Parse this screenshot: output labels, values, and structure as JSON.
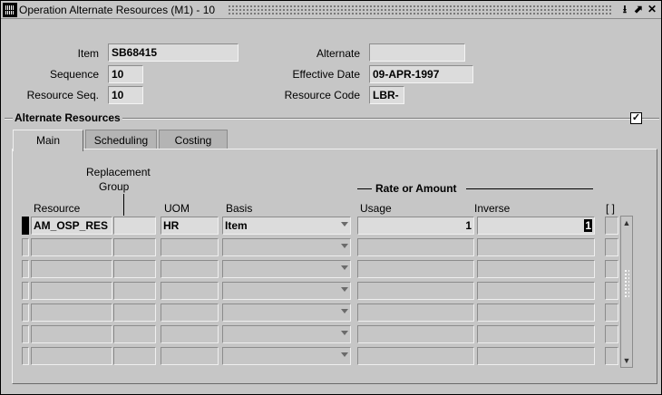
{
  "window": {
    "title": "Operation Alternate Resources (M1) - 10",
    "icons": [
      "form-icon",
      "minimize-icon",
      "maximize-icon",
      "close-icon"
    ]
  },
  "header_fields": {
    "item": {
      "label": "Item",
      "value": "SB68415"
    },
    "sequence": {
      "label": "Sequence",
      "value": "10"
    },
    "resource_seq": {
      "label": "Resource Seq.",
      "value": "10"
    },
    "alternate": {
      "label": "Alternate",
      "value": ""
    },
    "effective_date": {
      "label": "Effective Date",
      "value": "09-APR-1997"
    },
    "resource_code": {
      "label": "Resource Code",
      "value": "LBR-"
    }
  },
  "section": {
    "title": "Alternate Resources",
    "checked": true
  },
  "tabs": [
    {
      "label": "Main",
      "active": true
    },
    {
      "label": "Scheduling",
      "active": false
    },
    {
      "label": "Costing",
      "active": false
    }
  ],
  "table": {
    "headers": {
      "resource": "Resource",
      "replacement_group_1": "Replacement",
      "replacement_group_2": "Group",
      "uom": "UOM",
      "basis": "Basis",
      "rate_group": "Rate or Amount",
      "usage": "Usage",
      "inverse": "Inverse",
      "extra": "[ ]"
    },
    "rows": [
      {
        "resource": "AM_OSP_RES",
        "replacement_group": "",
        "uom": "HR",
        "basis": "Item",
        "usage": "1",
        "inverse": "1"
      },
      {
        "resource": "",
        "replacement_group": "",
        "uom": "",
        "basis": "",
        "usage": "",
        "inverse": ""
      },
      {
        "resource": "",
        "replacement_group": "",
        "uom": "",
        "basis": "",
        "usage": "",
        "inverse": ""
      },
      {
        "resource": "",
        "replacement_group": "",
        "uom": "",
        "basis": "",
        "usage": "",
        "inverse": ""
      },
      {
        "resource": "",
        "replacement_group": "",
        "uom": "",
        "basis": "",
        "usage": "",
        "inverse": ""
      },
      {
        "resource": "",
        "replacement_group": "",
        "uom": "",
        "basis": "",
        "usage": "",
        "inverse": ""
      },
      {
        "resource": "",
        "replacement_group": "",
        "uom": "",
        "basis": "",
        "usage": "",
        "inverse": ""
      }
    ]
  }
}
